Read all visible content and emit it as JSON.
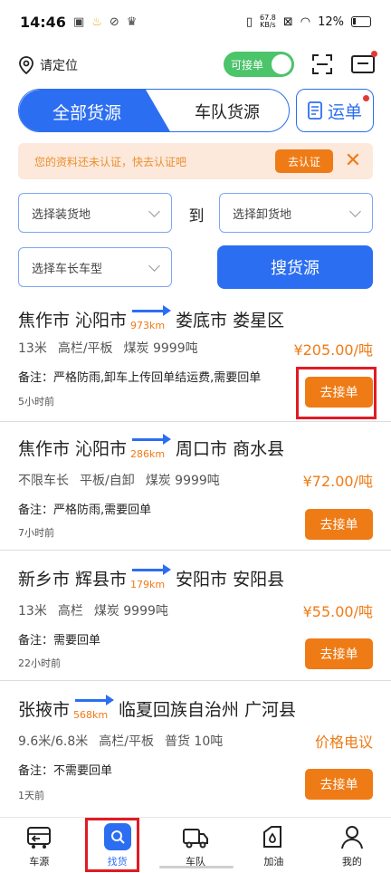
{
  "status_bar": {
    "time": "14:46",
    "speed_value": "67.8",
    "speed_unit": "KB/s",
    "battery": "12%"
  },
  "topbar": {
    "location_label": "请定位",
    "toggle_label": "可接单"
  },
  "tabs": {
    "active": "全部货源",
    "other": "车队货源",
    "waybill": "运单"
  },
  "notice": {
    "text": "您的资料还未认证，快去认证吧",
    "cert_button": "去认证",
    "close": "✕"
  },
  "filters": {
    "load_placeholder": "选择装货地",
    "to_label": "到",
    "unload_placeholder": "选择卸货地",
    "vehicle_placeholder": "选择车长车型",
    "search_button": "搜货源"
  },
  "cargo_list": [
    {
      "from": "焦作市 沁阳市",
      "distance": "973km",
      "to": "娄底市 娄星区",
      "specs": [
        "13米",
        "高栏/平板",
        "煤炭 9999吨"
      ],
      "price": "¥205.00/吨",
      "remark": "备注：严格防雨,卸车上传回单结运费,需要回单",
      "time_ago": "5小时前",
      "button": "去接单"
    },
    {
      "from": "焦作市 沁阳市",
      "distance": "286km",
      "to": "周口市 商水县",
      "specs": [
        "不限车长",
        "平板/自卸",
        "煤炭 9999吨"
      ],
      "price": "¥72.00/吨",
      "remark": "备注：严格防雨,需要回单",
      "time_ago": "7小时前",
      "button": "去接单"
    },
    {
      "from": "新乡市 辉县市",
      "distance": "179km",
      "to": "安阳市 安阳县",
      "specs": [
        "13米",
        "高栏",
        "煤炭 9999吨"
      ],
      "price": "¥55.00/吨",
      "remark": "备注：需要回单",
      "time_ago": "22小时前",
      "button": "去接单"
    },
    {
      "from": "张掖市",
      "distance": "568km",
      "to": "临夏回族自治州 广河县",
      "specs": [
        "9.6米/6.8米",
        "高栏/平板",
        "普货 10吨"
      ],
      "price": "价格电议",
      "remark": "备注：不需要回单",
      "time_ago": "1天前",
      "button": "去接单"
    }
  ],
  "bottom_nav": [
    {
      "label": "车源",
      "icon": "truck-source-icon"
    },
    {
      "label": "找货",
      "icon": "find-cargo-icon"
    },
    {
      "label": "车队",
      "icon": "fleet-truck-icon"
    },
    {
      "label": "加油",
      "icon": "fuel-icon"
    },
    {
      "label": "我的",
      "icon": "profile-icon"
    }
  ],
  "colors": {
    "primary": "#2c6ef2",
    "accent": "#ef7b16",
    "highlight": "#e01b24",
    "toggle": "#4cc46a"
  }
}
